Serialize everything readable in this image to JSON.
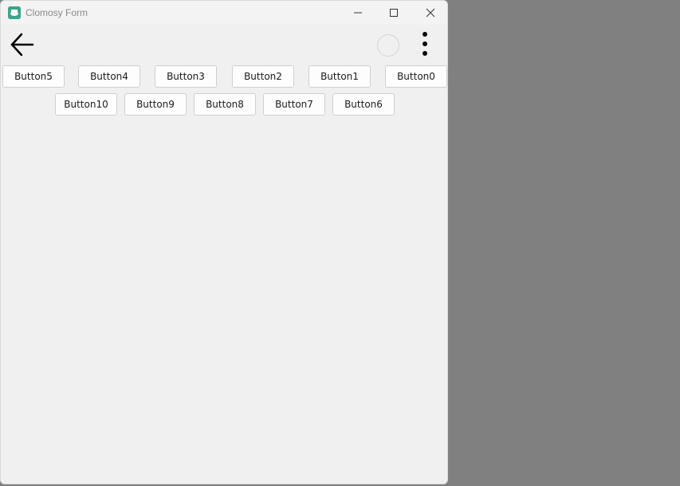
{
  "window": {
    "title": "Clomosy Form"
  },
  "titlebar": {
    "app_icon": "clomosy-app-icon",
    "minimize_icon": "minimize-icon",
    "maximize_icon": "maximize-icon",
    "close_icon": "close-icon"
  },
  "toolbar": {
    "back_icon": "arrow-left-icon",
    "more_icon": "more-vertical-icon"
  },
  "buttons": {
    "row1": [
      "Button5",
      "Button4",
      "Button3",
      "Button2",
      "Button1",
      "Button0"
    ],
    "row2": [
      "Button10",
      "Button9",
      "Button8",
      "Button7",
      "Button6"
    ]
  }
}
